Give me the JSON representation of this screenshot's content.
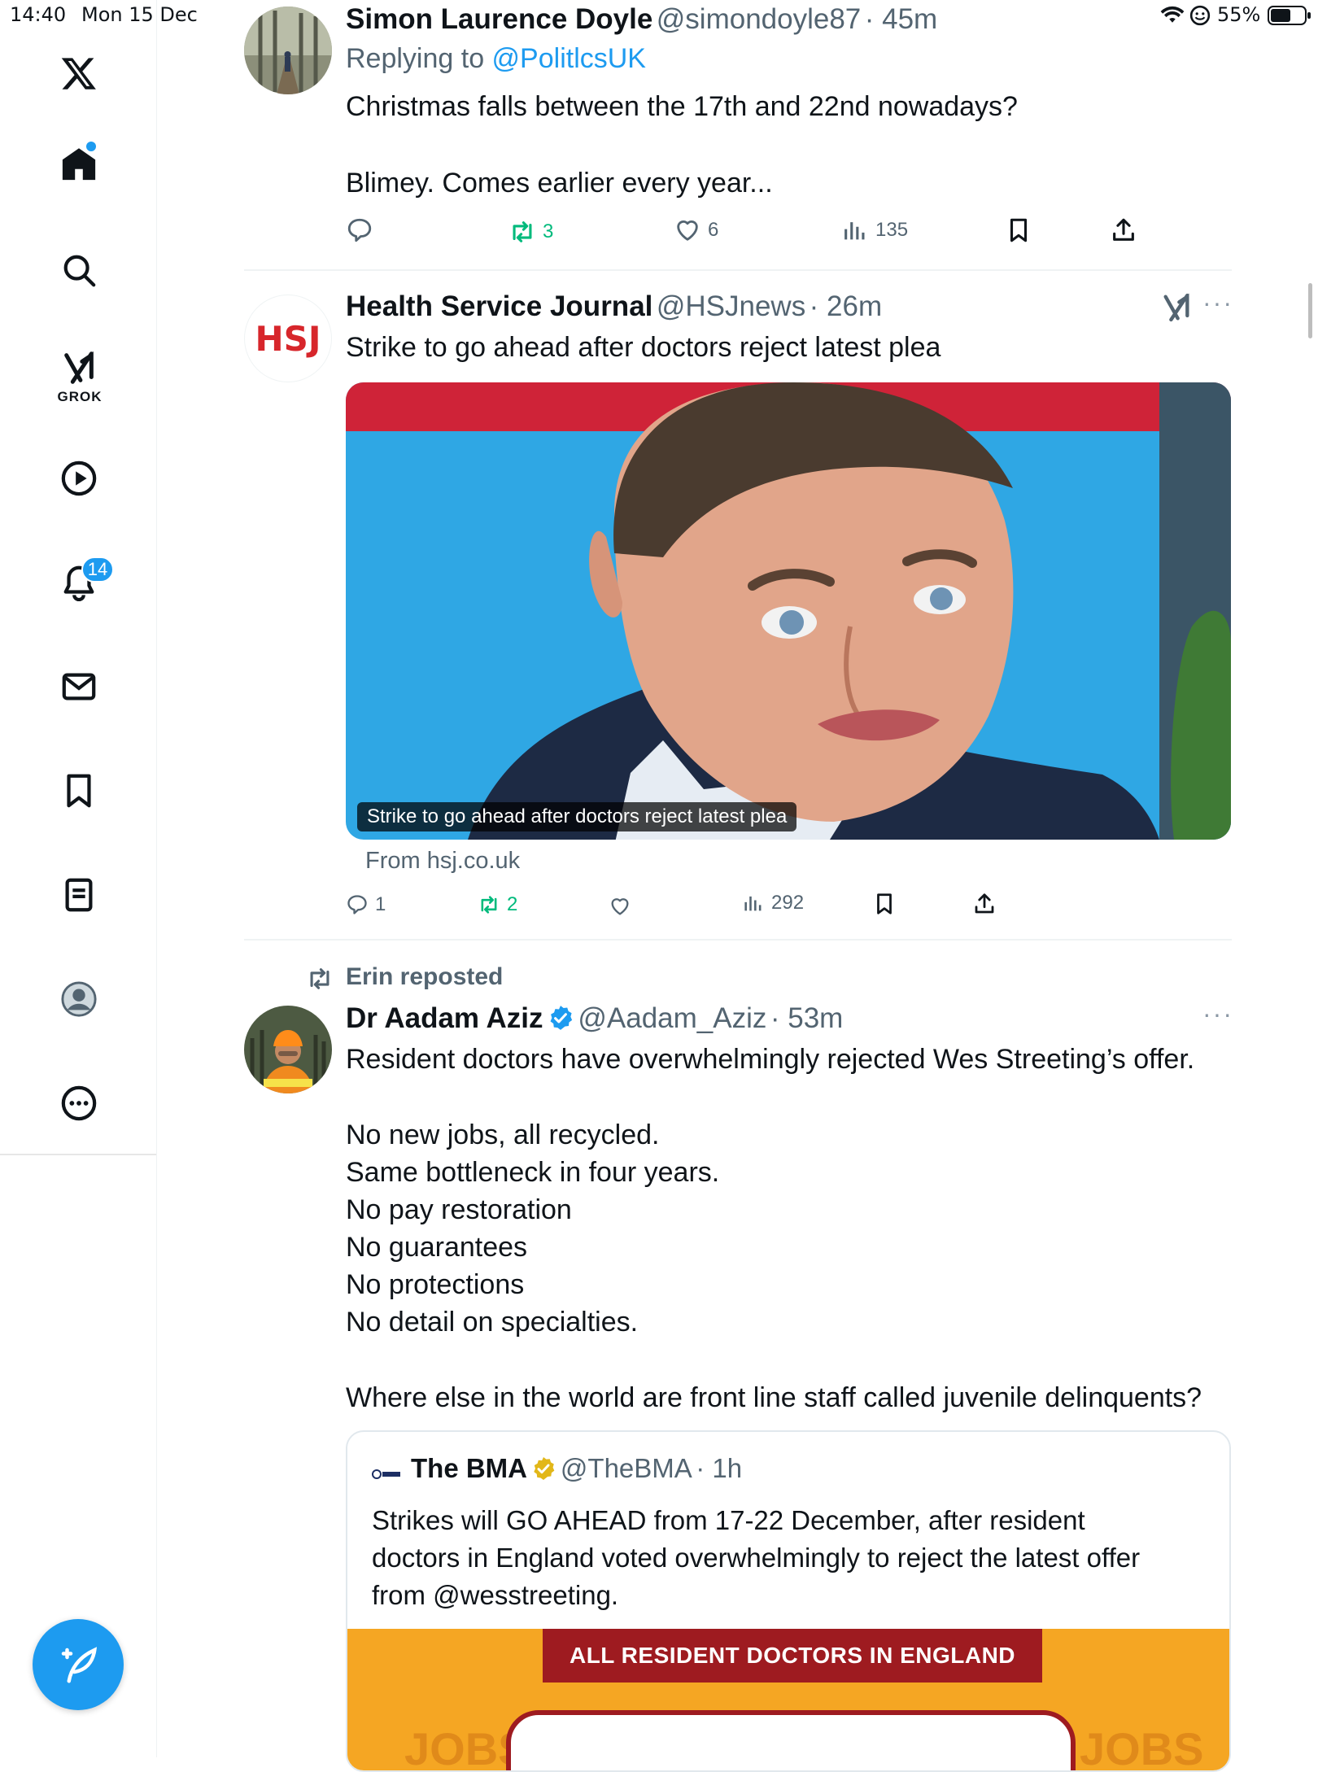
{
  "status_bar": {
    "time": "14:40",
    "date": "Mon 15 Dec",
    "battery": "55%"
  },
  "sidebar": {
    "grok_label": "GROK",
    "notifications_count": "14"
  },
  "tweets": [
    {
      "name": "Simon Laurence Doyle",
      "handle": "@simondoyle87",
      "time": "· 45m",
      "replying_prefix": "Replying to ",
      "replying_to": "@PolitlcsUK",
      "text_lines": [
        "Christmas falls between the 17th and 22nd nowadays?",
        "Blimey. Comes earlier every year..."
      ],
      "reposts": "3",
      "likes": "6",
      "views": "135"
    },
    {
      "name": "Health Service Journal",
      "handle": "@HSJnews",
      "time": "· 26m",
      "avatar_text": "HSJ",
      "text": "Strike to go ahead after doctors reject latest plea",
      "card_caption": "Strike to go ahead after doctors reject latest plea",
      "card_source": "From hsj.co.uk",
      "replies": "1",
      "reposts": "2",
      "views": "292"
    },
    {
      "reposted_by": "Erin reposted",
      "name": "Dr Aadam Aziz",
      "handle": "@Aadam_Aziz",
      "time": "· 53m",
      "text_lines": [
        "Resident doctors have overwhelmingly rejected Wes Streeting’s offer.",
        "No new jobs, all recycled.",
        "Same bottleneck in four years.",
        "No pay restoration",
        "No guarantees",
        "No protections",
        "No detail on specialties.",
        "Where else in the world are front line staff called juvenile delinquents?"
      ],
      "quote": {
        "name": "The BMA",
        "handle": "@TheBMA",
        "time": "· 1h",
        "text_lines": [
          "Strikes will GO AHEAD from 17-22 December, after resident",
          "doctors in England voted overwhelmingly to reject the latest offer",
          "from @wesstreeting."
        ],
        "banner": "ALL RESIDENT DOCTORS IN ENGLAND",
        "bg_word_left": "JOBS",
        "bg_word_right": "JOBS"
      }
    }
  ],
  "colors": {
    "accent": "#1d9bf0",
    "repost_green": "#00ba7c",
    "bma_orange": "#f5a623",
    "bma_red": "#9e1b20"
  }
}
